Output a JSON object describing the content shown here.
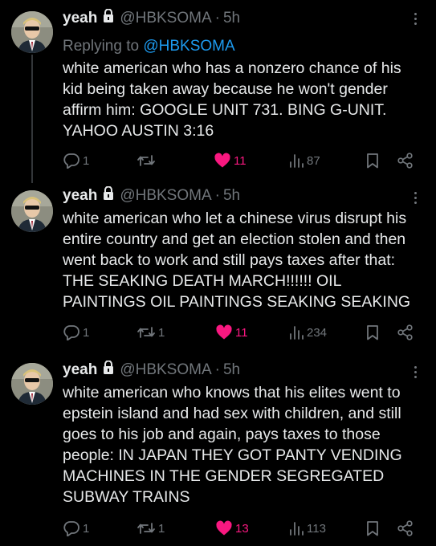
{
  "colors": {
    "background": "#000000",
    "text": "#e7e9ea",
    "muted": "#71767b",
    "link": "#1d9bf0",
    "like": "#f91880"
  },
  "tweets": [
    {
      "name": "yeah",
      "handle": "@HBKSOMA",
      "separator": "·",
      "time": "5h",
      "reply_prefix": "Replying to",
      "reply_target": "@HBKSOMA",
      "text": "white american who has a nonzero chance of his kid being taken away because he won't gender affirm him: GOOGLE UNIT 731. BING G-UNIT. YAHOO AUSTIN 3:16",
      "replies": "1",
      "retweets": "",
      "likes": "11",
      "views": "87"
    },
    {
      "name": "yeah",
      "handle": "@HBKSOMA",
      "separator": "·",
      "time": "5h",
      "text": "white american who let a chinese virus disrupt his entire country and get an election stolen and then went back to work and still pays taxes after that: THE SEAKING DEATH MARCH!!!!!! OIL PAINTINGS OIL PAINTINGS SEAKING SEAKING",
      "replies": "1",
      "retweets": "1",
      "likes": "11",
      "views": "234"
    },
    {
      "name": "yeah",
      "handle": "@HBKSOMA",
      "separator": "·",
      "time": "5h",
      "text": "white american who knows that his elites went to epstein island and had sex with children, and still goes to his job and again, pays taxes to those people: IN JAPAN THEY GOT PANTY VENDING MACHINES IN THE GENDER SEGREGATED SUBWAY TRAINS",
      "replies": "1",
      "retweets": "1",
      "likes": "13",
      "views": "113"
    }
  ]
}
